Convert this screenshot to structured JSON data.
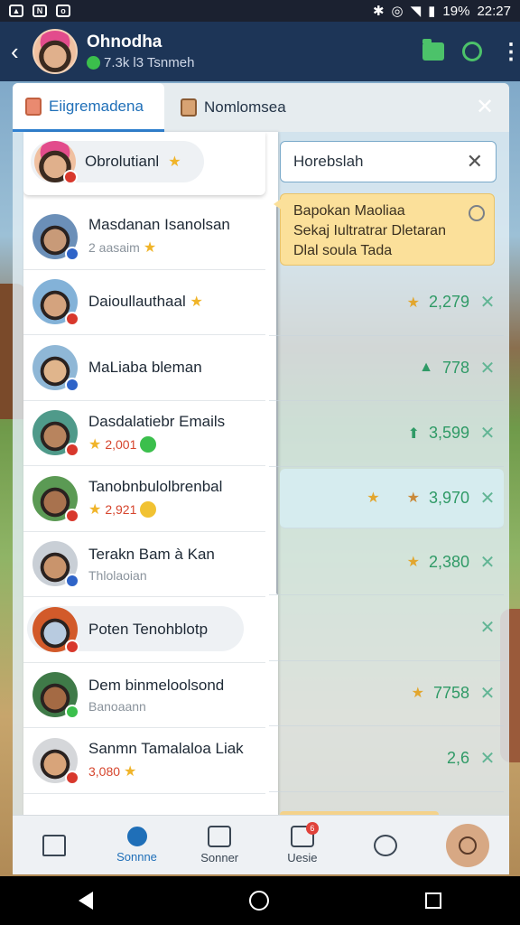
{
  "status_bar": {
    "icons": [
      "image-icon",
      "n-icon",
      "chat-icon"
    ],
    "battery": "19%",
    "time": "22:27"
  },
  "header": {
    "title": "Ohnodha",
    "subtitle_count": "7.3k",
    "subtitle_text": "l3 Tsnmeh"
  },
  "tabs": [
    {
      "label": "Eiigremadena"
    },
    {
      "label": "Nomlomsea"
    }
  ],
  "top_chip": {
    "label": "Obrolutianl"
  },
  "rows": [
    {
      "name": "Masdanan Isanolsan",
      "sub": "2 aasaim",
      "sub_icon": "star",
      "avatar": "#6b8fb8",
      "badge": "#2f64c8",
      "skin": "#c89a78"
    },
    {
      "name": "Daioullauthaal",
      "sub": "",
      "sub_icon": "",
      "name_icon": "star",
      "avatar": "#83b2d8",
      "badge": "#d8382c",
      "skin": "#d4a37e"
    },
    {
      "name": "MaLiaba bleman",
      "sub": "",
      "sub_icon": "",
      "avatar": "#8fb7d6",
      "badge": "#2f64c8",
      "skin": "#e0b58c"
    },
    {
      "name": "Dasdalatiebr Emails",
      "sub": "2,001",
      "sub_icon": "coin-green",
      "sub_star": true,
      "sub_red": true,
      "avatar": "#4f9a8a",
      "badge": "#d8382c",
      "skin": "#b8845e"
    },
    {
      "name": "Tanobnbulolbrenbal",
      "sub": "2,921",
      "sub_icon": "coin",
      "sub_star": true,
      "sub_red": true,
      "avatar": "#5b9a54",
      "badge": "#d8382c",
      "skin": "#a8724e"
    },
    {
      "name": "Terakn Bam à Kan",
      "sub": "Thlolaoian",
      "sub_icon": "",
      "avatar": "#c9cfd6",
      "badge": "#2f64c8",
      "skin": "#c9946c"
    },
    {
      "name": "Poten Tenohblotp",
      "sub": "",
      "sub_icon": "",
      "pill": true,
      "avatar": "#d25a2a",
      "badge": "#d8382c",
      "skin": "#b8cbe0"
    },
    {
      "name": "Dem binmeloolsond",
      "sub": "Banoaann",
      "sub_icon": "",
      "avatar": "#3f7a48",
      "badge": "#3bbf4c",
      "skin": "#a46a44"
    },
    {
      "name": "Sanmn Tamalaloa Liak",
      "sub": "3,080",
      "sub_icon": "star",
      "sub_red": true,
      "avatar": "#d5d7da",
      "badge": "#d8382c",
      "skin": "#d8a47a"
    }
  ],
  "search": {
    "value": "Horebslah"
  },
  "tooltip": {
    "line1": "Bapokan Maoliaa",
    "line2": "Sekaj Iultratrar Dletaran",
    "line3": "Dlal soula Tada"
  },
  "scores": [
    {
      "icon": "star",
      "value": "2,279",
      "color": "gold"
    },
    {
      "icon": "person",
      "value": "778",
      "color": "green"
    },
    {
      "icon": "arrow",
      "value": "3,599",
      "color": "green"
    },
    {
      "icon": "star",
      "value": "3,970",
      "color": "brown",
      "highlight": true
    },
    {
      "icon": "star",
      "value": "2,380",
      "color": "gold"
    },
    {
      "icon": "",
      "value": "",
      "color": ""
    },
    {
      "icon": "star",
      "value": "7758",
      "color": "gold"
    },
    {
      "icon": "",
      "value": "2,6",
      "color": "green"
    }
  ],
  "bottom_nav": [
    {
      "label": "",
      "icon": "home-icon"
    },
    {
      "label": "Sonnne",
      "icon": "search-icon",
      "active": true
    },
    {
      "label": "Sonner",
      "icon": "stamp-icon"
    },
    {
      "label": "Uesie",
      "icon": "people-icon",
      "badge": "6"
    },
    {
      "label": "",
      "icon": "at-icon"
    },
    {
      "label": "",
      "icon": "profile-icon"
    }
  ]
}
